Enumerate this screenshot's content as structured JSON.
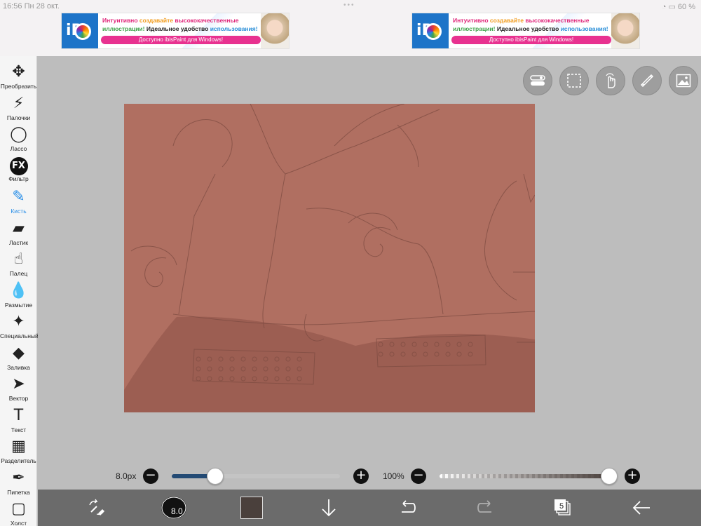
{
  "status": {
    "time": "16:56",
    "date": "Пн 28 окт.",
    "battery": "60 %"
  },
  "ad": {
    "logo_text": "iP",
    "line1_a": "Интуитивно",
    "line1_b": "создавайте",
    "line1_c": "высококачественные",
    "line2_a": "иллюстрации!",
    "line2_b": "Идеальное удобство",
    "line2_c": "использования!",
    "cta": "Доступно ibisPaint для Windows!"
  },
  "tools": [
    {
      "id": "transform",
      "label": "Преобразить",
      "icon": "move-arrows-icon",
      "glyph": "✥"
    },
    {
      "id": "wand",
      "label": "Палочки",
      "icon": "magic-wand-icon",
      "glyph": "⚡"
    },
    {
      "id": "lasso",
      "label": "Лассо",
      "icon": "lasso-icon",
      "glyph": "◯"
    },
    {
      "id": "filter",
      "label": "Фильтр",
      "icon": "fx-icon",
      "glyph": "FX"
    },
    {
      "id": "brush",
      "label": "Кисть",
      "icon": "brush-icon",
      "glyph": "✎"
    },
    {
      "id": "eraser",
      "label": "Ластик",
      "icon": "eraser-icon",
      "glyph": "▰"
    },
    {
      "id": "finger",
      "label": "Палец",
      "icon": "smudge-finger-icon",
      "glyph": "☝"
    },
    {
      "id": "blur",
      "label": "Размытие",
      "icon": "blur-drop-icon",
      "glyph": "💧"
    },
    {
      "id": "special",
      "label": "Специальный",
      "icon": "sparkle-pen-icon",
      "glyph": "✦"
    },
    {
      "id": "fill",
      "label": "Заливка",
      "icon": "bucket-icon",
      "glyph": "◆"
    },
    {
      "id": "vector",
      "label": "Вектор",
      "icon": "cursor-arrow-icon",
      "glyph": "➤"
    },
    {
      "id": "text",
      "label": "Текст",
      "icon": "text-t-icon",
      "glyph": "T"
    },
    {
      "id": "divider",
      "label": "Разделитель",
      "icon": "frame-divider-icon",
      "glyph": "▦"
    },
    {
      "id": "eyedropper",
      "label": "Пипетка",
      "icon": "eyedropper-icon",
      "glyph": "✒"
    },
    {
      "id": "canvas",
      "label": "Холст",
      "icon": "canvas-square-icon",
      "glyph": "▢"
    }
  ],
  "active_tool": "brush",
  "brush": {
    "size_label": "8.0px",
    "size_fraction": 0.26,
    "opacity_label": "100%",
    "opacity_fraction": 1.0,
    "preview_size": "8.0"
  },
  "buttons": {
    "minus": "−",
    "plus": "+"
  },
  "layers": {
    "count": "5"
  },
  "colors": {
    "canvas_fill": "#b06f61",
    "ground": "#9c5e52",
    "accent": "#2a8fe8",
    "size_track": "#234a74",
    "primary_color": "#4a403c"
  }
}
